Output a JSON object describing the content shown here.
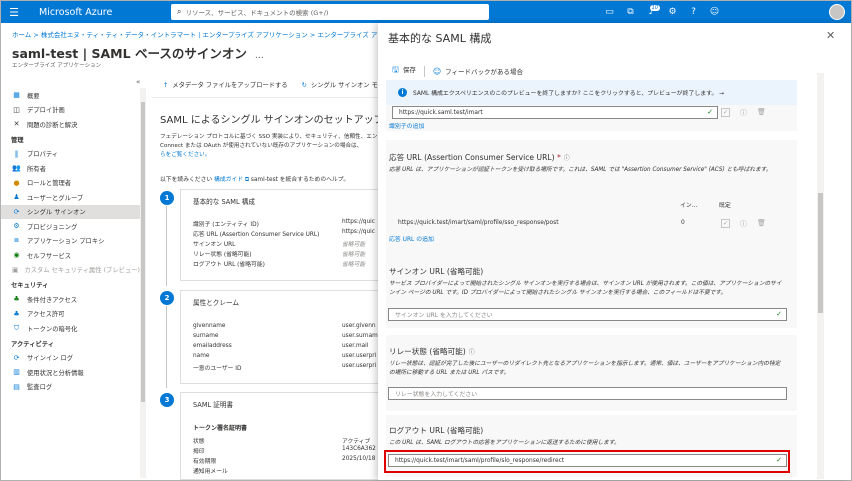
{
  "topbar": {
    "brand": "Microsoft Azure",
    "search_placeholder": "リソース、サービス、ドキュメントの検索 (G+/)",
    "notification_count": "10"
  },
  "breadcrumb": "ホーム > 株式会社エヌ・ティ・ティ・データ・イントラマート | エンタープライズ アプリケーション > エンタープライズ アプリケーション",
  "page": {
    "title": "saml-test | SAML ベースのサインオン",
    "subtitle": "エンタープライズ アプリケーション"
  },
  "sidebar": {
    "items_top": [
      {
        "label": "概要",
        "icon": "grid-icon"
      },
      {
        "label": "デプロイ計画",
        "icon": "book-icon"
      },
      {
        "label": "問題の診断と解決",
        "icon": "wrench-icon"
      }
    ],
    "section_manage": "管理",
    "items_manage": [
      {
        "label": "プロパティ",
        "icon": "bars-icon",
        "active": false
      },
      {
        "label": "所有者",
        "icon": "people-icon",
        "active": false
      },
      {
        "label": "ロールと管理者",
        "icon": "roles-icon",
        "active": false
      },
      {
        "label": "ユーザーとグループ",
        "icon": "users-icon",
        "active": false
      },
      {
        "label": "シングル サインオン",
        "icon": "sso-icon",
        "active": true
      },
      {
        "label": "プロビジョニング",
        "icon": "sync-icon",
        "active": false
      },
      {
        "label": "アプリケーション プロキシ",
        "icon": "proxy-icon",
        "active": false
      },
      {
        "label": "セルフサービス",
        "icon": "selfservice-icon",
        "active": false
      },
      {
        "label": "カスタム セキュリティ属性 (プレビュー)",
        "icon": "attr-icon",
        "active": false,
        "disabled": true
      }
    ],
    "section_security": "セキュリティ",
    "items_security": [
      {
        "label": "条件付きアクセス",
        "icon": "conditional-icon"
      },
      {
        "label": "アクセス許可",
        "icon": "permission-icon"
      },
      {
        "label": "トークンの暗号化",
        "icon": "shield-icon"
      }
    ],
    "section_activity": "アクティビティ",
    "items_activity": [
      {
        "label": "サインイン ログ",
        "icon": "signin-icon"
      },
      {
        "label": "使用状況と分析情報",
        "icon": "chart-icon"
      },
      {
        "label": "監査ログ",
        "icon": "audit-icon"
      }
    ]
  },
  "commandbar": {
    "upload": "メタデータ ファイルをアップロードする",
    "change": "シングル サインオン モードの変"
  },
  "main": {
    "title": "SAML によるシングル サインオンのセットアップ",
    "desc_line1": "フェデレーション プロトコルに基づく SSO 実装により、セキュリティ、信頼性、エン",
    "desc_line2": "Connect または OAuth が使用されていない既存のアプリケーションの場合は、",
    "desc_link": "らをご覧ください。",
    "guide_prefix": "以下を読みください",
    "guide_link": "構成ガイド",
    "guide_suffix": "saml-test を統合するためのヘルプ。"
  },
  "cards": [
    {
      "step": "1",
      "title": "基本的な SAML 構成",
      "rows": [
        {
          "k": "識別子 (エンティティ ID)",
          "v": "https://quic",
          "muted": false
        },
        {
          "k": "応答 URL (Assertion Consumer Service URL)",
          "v": "https://quic",
          "muted": false
        },
        {
          "k": "サインオン URL",
          "v": "省略可能",
          "muted": true
        },
        {
          "k": "リレー状態 (省略可能)",
          "v": "省略可能",
          "muted": true
        },
        {
          "k": "ログアウト URL (省略可能)",
          "v": "省略可能",
          "muted": true
        }
      ]
    },
    {
      "step": "2",
      "title": "属性とクレーム",
      "rows": [
        {
          "k": "givenname",
          "v": "user.givenn"
        },
        {
          "k": "surname",
          "v": "user.surnam"
        },
        {
          "k": "emailaddress",
          "v": "user.mail"
        },
        {
          "k": "name",
          "v": "user.userpri"
        },
        {
          "k": "一意のユーザー ID",
          "v": "user.userpri"
        }
      ]
    },
    {
      "step": "3",
      "title": "SAML 証明書",
      "subtitle": "トークン署名証明書",
      "rows": [
        {
          "k": "状態",
          "v": "アクティブ"
        },
        {
          "k": "拇印",
          "v": "143C6A362"
        },
        {
          "k": "有効期限",
          "v": "2025/10/18"
        },
        {
          "k": "通知用メール",
          "v": ""
        }
      ]
    }
  ],
  "panel": {
    "title": "基本的な SAML 構成",
    "save": "保存",
    "feedback": "フィードバックがある場合",
    "info": "SAML 構成エクスペリエンスのこのプレビューを終了しますか? ここをクリックすると、プレビューが終了します。 →",
    "identifier_value": "https://quick.saml.test/imart",
    "identifier_add": "識別子の追加",
    "reply": {
      "title": "応答 URL (Assertion Consumer Service URL)",
      "req": "*",
      "desc": "応答 URL は、アプリケーションが認証トークンを受け取る場所です。これは、SAML では \"Assertion Consumer Service\" (ACS) とも呼ばれます。",
      "col_index": "イン...",
      "col_default": "既定",
      "row_url": "https://quick.test/imart/saml/profile/sso_response/post",
      "row_index": "0",
      "add": "応答 URL の追加"
    },
    "signon": {
      "title": "サインオン URL (省略可能)",
      "desc1": "サービス プロバイダーによって開始されたシングル サインオンを実行する場合は、サインオン URL が使用されます。この値は、アプリケーションのサイ",
      "desc2": "ンイン ページの URL です。ID プロバイダーによって開始されたシングル サインオンを実行する場合、このフィールドは不要です。",
      "placeholder": "サインオン URL を入力してください"
    },
    "relay": {
      "title": "リレー状態 (省略可能)",
      "desc1": "リレー状態は、認証が完了した後にユーザーのリダイレクト先となるアプリケーションを指示します。通常、値は、ユーザーをアプリケーション内の特定",
      "desc2": "の場所に移動する URL または URL パスです。",
      "placeholder": "リレー状態を入力してください"
    },
    "logout": {
      "title": "ログアウト URL (省略可能)",
      "desc": "この URL は、SAML ログアウトの応答をアプリケーションに返送するために使用します。",
      "value": "https://quick.test/imart/saml/profile/slo_response/redirect"
    }
  }
}
